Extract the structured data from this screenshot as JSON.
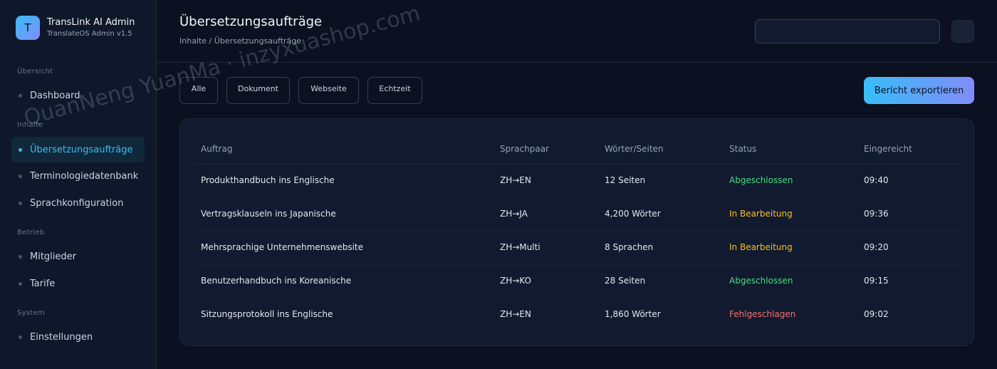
{
  "brand": {
    "logo_letter": "T",
    "name": "TransLink AI Admin",
    "subtitle": "TranslateOS Admin v1.5"
  },
  "sidebar": {
    "sections": [
      {
        "title": "Übersicht"
      },
      {
        "title": "Inhalte"
      },
      {
        "title": "Betrieb"
      },
      {
        "title": "System"
      }
    ],
    "items": [
      {
        "label": "Dashboard",
        "active": false
      },
      {
        "label": "Übersetzungsaufträge",
        "active": true
      },
      {
        "label": "Terminologiedatenbank",
        "active": false
      },
      {
        "label": "Sprachkonfiguration",
        "active": false
      },
      {
        "label": "Mitglieder",
        "active": false
      },
      {
        "label": "Tarife",
        "active": false
      },
      {
        "label": "Einstellungen",
        "active": false
      }
    ]
  },
  "header": {
    "title": "Übersetzungsaufträge",
    "breadcrumb": "Inhalte / Übersetzungsaufträge",
    "search_value": ""
  },
  "filters": [
    "Alle",
    "Dokument",
    "Webseite",
    "Echtzeit"
  ],
  "export_label": "Bericht exportieren",
  "table": {
    "headers": [
      "Auftrag",
      "Sprachpaar",
      "Wörter/Seiten",
      "Status",
      "Eingereicht"
    ],
    "rows": [
      {
        "job": "Produkthandbuch ins Englische",
        "pair": "ZH→EN",
        "amount": "12 Seiten",
        "status": "Abgeschlossen",
        "status_color": "#4ade80",
        "time": "09:40"
      },
      {
        "job": "Vertragsklauseln ins Japanische",
        "pair": "ZH→JA",
        "amount": "4,200 Wörter",
        "status": "In Bearbeitung",
        "status_color": "#fbbf24",
        "time": "09:36"
      },
      {
        "job": "Mehrsprachige Unternehmenswebsite",
        "pair": "ZH→Multi",
        "amount": "8 Sprachen",
        "status": "In Bearbeitung",
        "status_color": "#fbbf24",
        "time": "09:20"
      },
      {
        "job": "Benutzerhandbuch ins Koreanische",
        "pair": "ZH→KO",
        "amount": "28 Seiten",
        "status": "Abgeschlossen",
        "status_color": "#4ade80",
        "time": "09:15"
      },
      {
        "job": "Sitzungsprotokoll ins Englische",
        "pair": "ZH→EN",
        "amount": "1,860 Wörter",
        "status": "Fehlgeschlagen",
        "status_color": "#f87171",
        "time": "09:02"
      }
    ]
  },
  "watermark": "QuanNeng YuanMa · inzyxuashop.com",
  "colors": {
    "accent": "#38bdf8",
    "accent_2": "#818cf8",
    "background": "#0b1120",
    "card": "#111a2e"
  }
}
